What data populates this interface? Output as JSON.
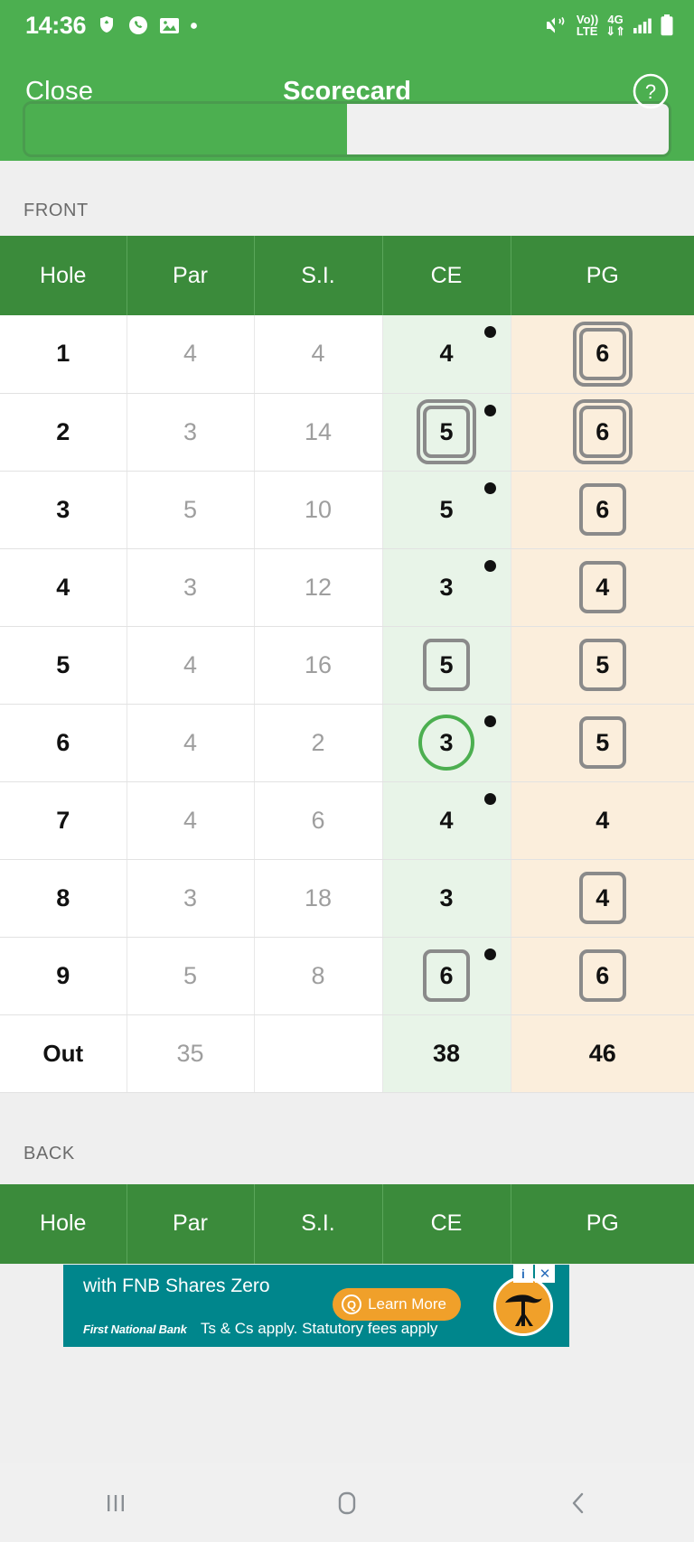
{
  "status_bar": {
    "time": "14:36",
    "left_icons": [
      "brave-icon",
      "phone-icon",
      "gallery-icon",
      "dot-icon"
    ],
    "right_icons": [
      "mute-vibrate-icon",
      "volte-icon",
      "4g-data-icon",
      "signal-icon",
      "battery-icon"
    ],
    "volte_label_top": "Vo))",
    "volte_label_bottom": "LTE",
    "network_label": "4G"
  },
  "app_bar": {
    "close_label": "Close",
    "title": "Scorecard",
    "help_icon": "question-mark-circle-icon"
  },
  "segmented_control": {
    "options": [
      "",
      ""
    ],
    "selected_index": 1
  },
  "sections": {
    "front_label": "FRONT",
    "back_label": "BACK"
  },
  "columns": [
    "Hole",
    "Par",
    "S.I.",
    "CE",
    "PG"
  ],
  "front_rows": [
    {
      "hole": "1",
      "par": "4",
      "si": "4",
      "ce": {
        "value": "4",
        "marker": "none",
        "dot": true
      },
      "pg": {
        "value": "6",
        "marker": "double",
        "dot": false
      }
    },
    {
      "hole": "2",
      "par": "3",
      "si": "14",
      "ce": {
        "value": "5",
        "marker": "double",
        "dot": true
      },
      "pg": {
        "value": "6",
        "marker": "double",
        "dot": false
      }
    },
    {
      "hole": "3",
      "par": "5",
      "si": "10",
      "ce": {
        "value": "5",
        "marker": "none",
        "dot": true
      },
      "pg": {
        "value": "6",
        "marker": "single",
        "dot": false
      }
    },
    {
      "hole": "4",
      "par": "3",
      "si": "12",
      "ce": {
        "value": "3",
        "marker": "none",
        "dot": true
      },
      "pg": {
        "value": "4",
        "marker": "single",
        "dot": false
      }
    },
    {
      "hole": "5",
      "par": "4",
      "si": "16",
      "ce": {
        "value": "5",
        "marker": "single",
        "dot": false
      },
      "pg": {
        "value": "5",
        "marker": "single",
        "dot": false
      }
    },
    {
      "hole": "6",
      "par": "4",
      "si": "2",
      "ce": {
        "value": "3",
        "marker": "circle",
        "dot": true
      },
      "pg": {
        "value": "5",
        "marker": "single",
        "dot": false
      }
    },
    {
      "hole": "7",
      "par": "4",
      "si": "6",
      "ce": {
        "value": "4",
        "marker": "none",
        "dot": true
      },
      "pg": {
        "value": "4",
        "marker": "none",
        "dot": false
      }
    },
    {
      "hole": "8",
      "par": "3",
      "si": "18",
      "ce": {
        "value": "3",
        "marker": "none",
        "dot": false
      },
      "pg": {
        "value": "4",
        "marker": "single",
        "dot": false
      }
    },
    {
      "hole": "9",
      "par": "5",
      "si": "8",
      "ce": {
        "value": "6",
        "marker": "single",
        "dot": true
      },
      "pg": {
        "value": "6",
        "marker": "single",
        "dot": false
      }
    }
  ],
  "front_total": {
    "hole": "Out",
    "par": "35",
    "si": "",
    "ce": {
      "value": "38",
      "marker": "none",
      "dot": false
    },
    "pg": {
      "value": "46",
      "marker": "none",
      "dot": false
    }
  },
  "ad": {
    "headline": "with FNB Shares Zero",
    "brand": "First National Bank",
    "legal": "Ts & Cs apply. Statutory fees apply",
    "cta_label": "Learn More",
    "cta_icon": "magnifier-icon",
    "info_icon": "i",
    "close_icon": "✕",
    "logo_icon": "acacia-tree-icon"
  },
  "nav_bar": {
    "recents_label": "|||",
    "home_icon": "home-square-icon",
    "back_icon": "back-chevron-icon"
  },
  "colors": {
    "brand_green": "#4caf50",
    "header_green": "#3b8b3b",
    "ce_cell_bg": "#e8f4e8",
    "pg_cell_bg": "#fbeedc",
    "page_bg": "#efefef",
    "ad_teal": "#00868c",
    "ad_orange": "#f0a02a"
  }
}
